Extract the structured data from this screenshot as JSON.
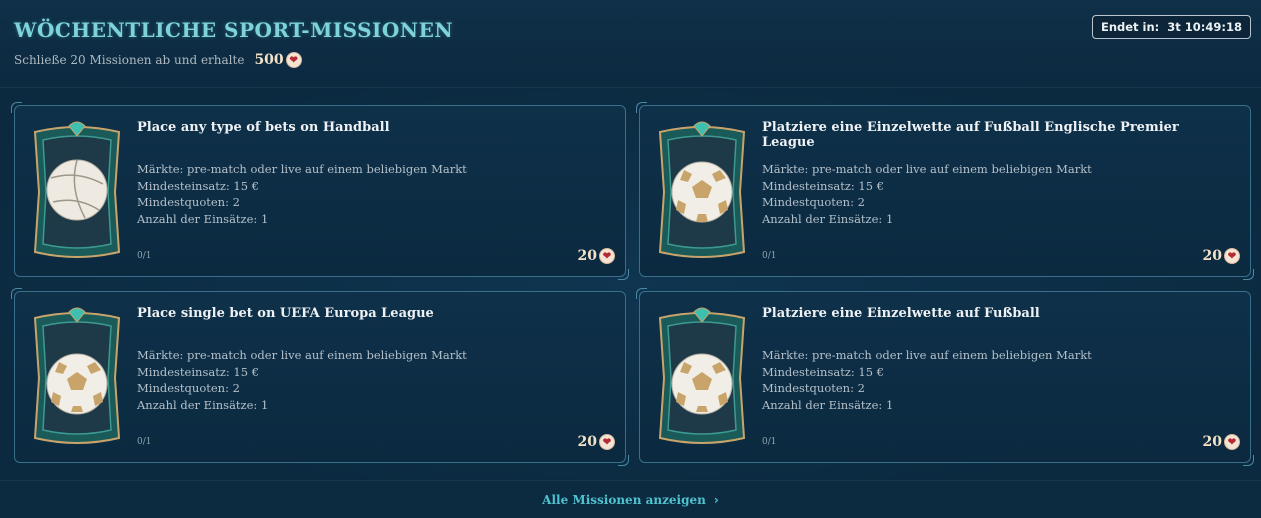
{
  "header": {
    "title": "WÖCHENTLICHE SPORT-MISSIONEN",
    "subtitle": "Schließe 20 Missionen ab und erhalte",
    "total_reward": "500",
    "timer": "Endet in:  3t 10:49:18"
  },
  "missions": [
    {
      "title": "Place any type of bets on Handball",
      "ball": "volleyball-icon",
      "markets": "Märkte:  pre-match oder live auf einem beliebigen Markt",
      "min_stake": "Mindesteinsatz: 15 €",
      "min_odds": "Mindestquoten: 2",
      "bet_count": "Anzahl der Einsätze: 1",
      "progress": "0/1",
      "reward": "20"
    },
    {
      "title": "Platziere eine Einzelwette auf Fußball Englische Premier League",
      "ball": "soccer-ball-icon",
      "markets": "Märkte:  pre-match oder live auf einem beliebigen Markt",
      "min_stake": "Mindesteinsatz: 15 €",
      "min_odds": "Mindestquoten: 2",
      "bet_count": "Anzahl der Einsätze: 1",
      "progress": "0/1",
      "reward": "20"
    },
    {
      "title": "Place single bet on UEFA Europa League",
      "ball": "soccer-ball-icon",
      "markets": "Märkte:  pre-match oder live auf einem beliebigen Markt",
      "min_stake": "Mindesteinsatz: 15 €",
      "min_odds": "Mindestquoten: 2",
      "bet_count": "Anzahl der Einsätze: 1",
      "progress": "0/1",
      "reward": "20"
    },
    {
      "title": "Platziere eine Einzelwette auf Fußball",
      "ball": "soccer-ball-icon",
      "markets": "Märkte:  pre-match oder live auf einem beliebigen Markt",
      "min_stake": "Mindesteinsatz: 15 €",
      "min_odds": "Mindestquoten: 2",
      "bet_count": "Anzahl der Einsätze: 1",
      "progress": "0/1",
      "reward": "20"
    }
  ],
  "footer": {
    "link_label": "Alle Missionen anzeigen"
  },
  "colors": {
    "accent": "#4fc3cf",
    "title": "#7fd3d8",
    "background": "#0d2a40",
    "heart": "#b52a33",
    "frame_teal": "#1f6f6a",
    "frame_gold": "#c9a46a"
  }
}
